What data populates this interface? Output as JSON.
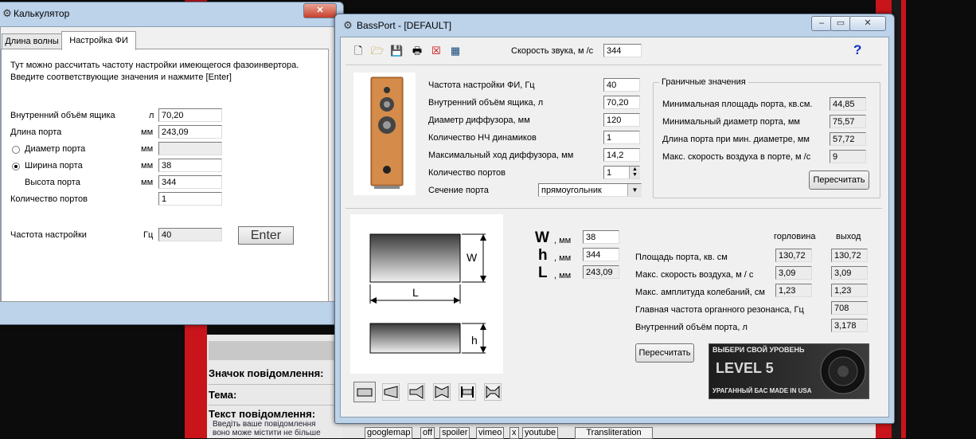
{
  "forum": {
    "row1": "Значок повідомлення:",
    "row2": "Тема:",
    "row3": "Текст повідомлення:",
    "hint1": "Введіть ваше повідомлення",
    "hint2": "воно може містити не більше",
    "tags": [
      "googlemap",
      "off",
      "spoiler",
      "vimeo",
      "x",
      "youtube"
    ],
    "translit": "Transliteration"
  },
  "calc": {
    "title": "Калькулятор",
    "close_label": "✕",
    "tabs": [
      "Длина волны",
      "Настройка ФИ"
    ],
    "intro1": "Тут можно рассчитать частоту настройки имеющегося фазоинвертора.",
    "intro2": "Введите соответствующие значения и нажмите  [Enter]",
    "rows": [
      {
        "label": "Внутренний объём ящика",
        "unit": "л",
        "value": "70,20"
      },
      {
        "label": "Длина порта",
        "unit": "мм",
        "value": "243,09"
      },
      {
        "label": "Диаметр порта",
        "unit": "мм",
        "value": ""
      },
      {
        "label": "Ширина порта",
        "unit": "мм",
        "value": "38"
      },
      {
        "label": "Высота порта",
        "unit": "мм",
        "value": "344"
      },
      {
        "label": "Количество портов",
        "unit": "",
        "value": "1"
      }
    ],
    "freq_label": "Частота настройки",
    "freq_unit": "Гц",
    "freq_value": "40",
    "enter_label": "Enter"
  },
  "bassport": {
    "title": "BassPort - [DEFAULT]",
    "speed_label": "Скорость звука, м /с",
    "speed_value": "344",
    "help": "?",
    "params": [
      {
        "label": "Частота настройки ФИ, Гц",
        "value": "40"
      },
      {
        "label": "Внутренний объём ящика, л",
        "value": "70,20"
      },
      {
        "label": "Диаметр диффузора, мм",
        "value": "120"
      },
      {
        "label": "Количество НЧ динамиков",
        "value": "1"
      },
      {
        "label": "Максимальный ход диффузора, мм",
        "value": "14,2"
      },
      {
        "label": "Количество портов",
        "value": "1"
      },
      {
        "label": "Сечение порта",
        "value": "прямоугольник"
      }
    ],
    "limits_title": "Граничные значения",
    "limits": [
      {
        "label": "Минимальная площадь порта, кв.см.",
        "value": "44,85"
      },
      {
        "label": "Минимальный диаметр порта, мм",
        "value": "75,57"
      },
      {
        "label": "Длина порта при мин. диаметре, мм",
        "value": "57,72"
      },
      {
        "label": "Макс. скорость воздуха в порте, м /с",
        "value": "9"
      }
    ],
    "recalc_label": "Пересчитать",
    "dims": [
      {
        "letter": "W",
        "unit": ", мм",
        "value": "38"
      },
      {
        "letter": "h",
        "unit": ", мм",
        "value": "344"
      },
      {
        "letter": "L",
        "unit": ", мм",
        "value": "243,09"
      }
    ],
    "diag_w": "W",
    "diag_l": "L",
    "diag_h": "h",
    "col_throat": "горловина",
    "col_exit": "выход",
    "results": [
      {
        "label": "Площадь порта, кв. см",
        "throat": "130,72",
        "exit": "130,72"
      },
      {
        "label": "Макс. скорость воздуха, м / с",
        "throat": "3,09",
        "exit": "3,09"
      },
      {
        "label": "Макс. амплитуда колебаний, см",
        "throat": "1,23",
        "exit": "1,23"
      },
      {
        "label": "Главная частота органного резонанса, Гц",
        "throat": "",
        "exit": "708"
      },
      {
        "label": "Внутренний объём порта, л",
        "throat": "",
        "exit": "3,178"
      }
    ],
    "ad": {
      "line1": "ВЫБЕРИ СВОЙ УРОВЕНЬ",
      "line2": "LEVEL 5",
      "line3": "УРАГАННЫЙ БАС MADE IN USA"
    }
  }
}
